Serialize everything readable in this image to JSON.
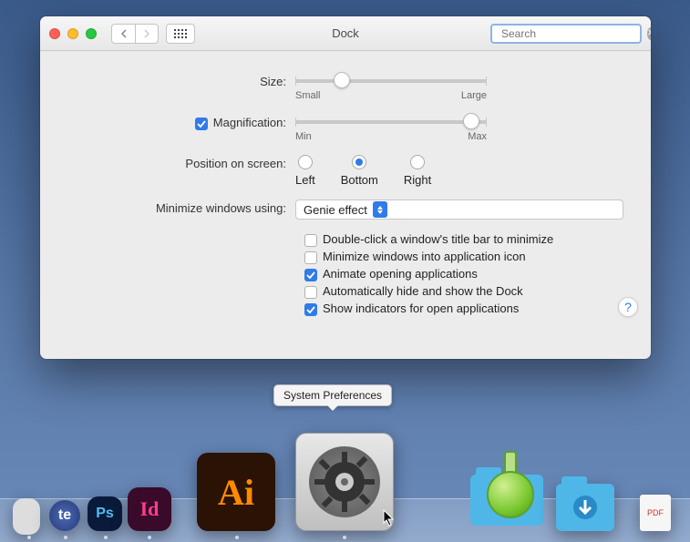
{
  "window": {
    "title": "Dock"
  },
  "search": {
    "placeholder": "Search",
    "value": ""
  },
  "size": {
    "label": "Size:",
    "value_pct": 22,
    "min_label": "Small",
    "max_label": "Large"
  },
  "magnification": {
    "enabled": true,
    "label": "Magnification:",
    "value_pct": 96,
    "min_label": "Min",
    "max_label": "Max"
  },
  "position": {
    "label": "Position on screen:",
    "options": [
      {
        "value": "left",
        "label": "Left",
        "selected": false
      },
      {
        "value": "bottom",
        "label": "Bottom",
        "selected": true
      },
      {
        "value": "right",
        "label": "Right",
        "selected": false
      }
    ]
  },
  "minimize_effect": {
    "label": "Minimize windows using:",
    "selected": "Genie effect"
  },
  "options": [
    {
      "key": "dblclick_minimize",
      "label": "Double-click a window's title bar to minimize",
      "checked": false
    },
    {
      "key": "minimize_into_app",
      "label": "Minimize windows into application icon",
      "checked": false
    },
    {
      "key": "animate_opening",
      "label": "Animate opening applications",
      "checked": true
    },
    {
      "key": "autohide",
      "label": "Automatically hide and show the Dock",
      "checked": false
    },
    {
      "key": "show_indicators",
      "label": "Show indicators for open applications",
      "checked": true
    }
  ],
  "tooltip": "System Preferences",
  "dock_apps": [
    {
      "name": "Xtensions",
      "short": ""
    },
    {
      "name": "TextExpander",
      "short": "te"
    },
    {
      "name": "Adobe Photoshop",
      "short": "Ps"
    },
    {
      "name": "Adobe InDesign",
      "short": "Id"
    },
    {
      "name": "Adobe Illustrator",
      "short": "Ai"
    },
    {
      "name": "System Preferences",
      "short": ""
    },
    {
      "name": "Flask App",
      "short": ""
    },
    {
      "name": "Downloads",
      "short": ""
    },
    {
      "name": "PDF",
      "short": "PDF"
    }
  ]
}
